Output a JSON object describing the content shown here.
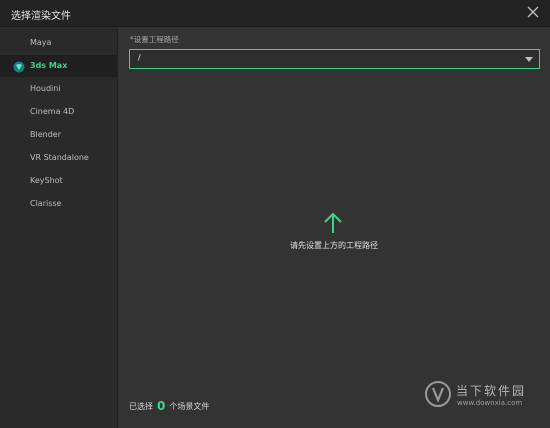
{
  "window": {
    "title": "选择渲染文件"
  },
  "sidebar": {
    "items": [
      {
        "label": "Maya",
        "active": false
      },
      {
        "label": "3ds Max",
        "active": true
      },
      {
        "label": "Houdini",
        "active": false
      },
      {
        "label": "Cinema 4D",
        "active": false
      },
      {
        "label": "Blender",
        "active": false
      },
      {
        "label": "VR Standalone",
        "active": false
      },
      {
        "label": "KeyShot",
        "active": false
      },
      {
        "label": "Clarisse",
        "active": false
      }
    ]
  },
  "main": {
    "path_label": "*设置工程路径",
    "path_value": "/",
    "empty_hint": "请先设置上方的工程路径",
    "footer": {
      "prefix": "已选择",
      "count": "0",
      "suffix": "个场景文件"
    }
  },
  "watermark": {
    "name": "当下软件园",
    "url": "www.downxia.com"
  },
  "colors": {
    "accent": "#3dd48b",
    "background": "#333333"
  },
  "icons": {
    "close": "close-icon",
    "active_item": "3dsmax-logo-icon",
    "arrow": "arrow-up-icon",
    "dropdown": "chevron-down-icon"
  }
}
